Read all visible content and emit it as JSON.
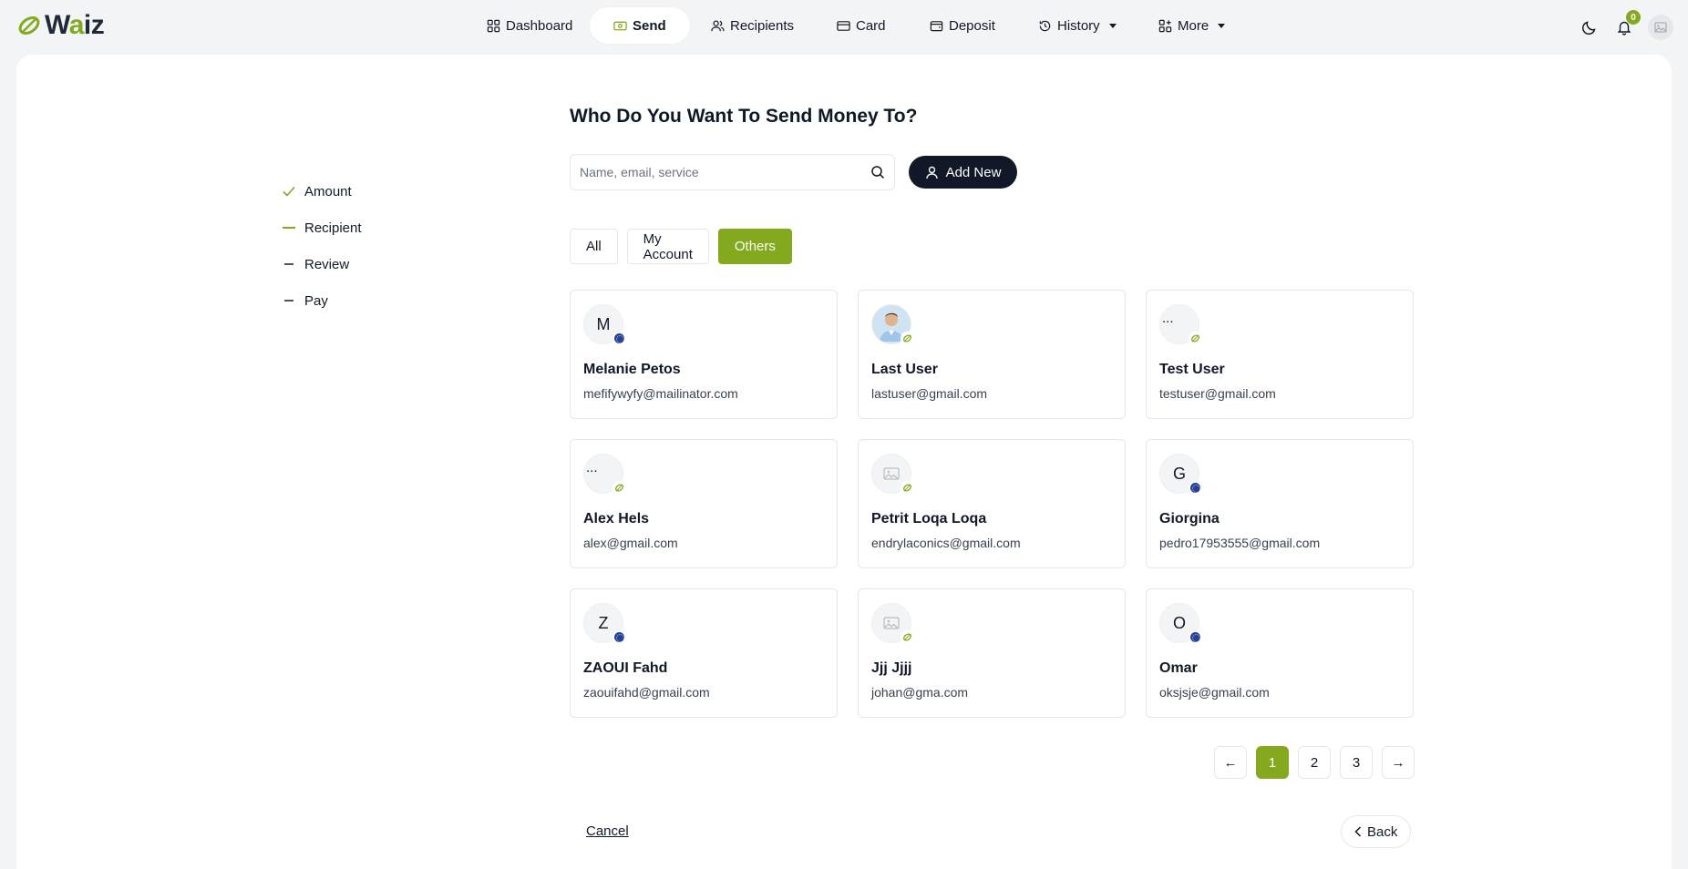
{
  "app": {
    "logo_text": "Waiz",
    "accent": "#84a91f"
  },
  "nav": {
    "items": [
      {
        "label": "Dashboard",
        "icon": "grid-icon"
      },
      {
        "label": "Send",
        "icon": "money-icon",
        "active": true
      },
      {
        "label": "Recipients",
        "icon": "users-icon"
      },
      {
        "label": "Card",
        "icon": "card-icon"
      },
      {
        "label": "Deposit",
        "icon": "wallet-icon"
      },
      {
        "label": "History",
        "icon": "history-icon",
        "dropdown": true
      },
      {
        "label": "More",
        "icon": "apps-icon",
        "dropdown": true
      }
    ],
    "notification_count": "0"
  },
  "steps": [
    {
      "label": "Amount",
      "state": "done"
    },
    {
      "label": "Recipient",
      "state": "current"
    },
    {
      "label": "Review",
      "state": "pending"
    },
    {
      "label": "Pay",
      "state": "pending"
    }
  ],
  "main": {
    "title": "Who Do You Want To Send Money To?",
    "search_placeholder": "Name, email, service",
    "search_value": "",
    "add_new_label": "Add New",
    "filters": [
      {
        "label": "All"
      },
      {
        "label": "My Account"
      },
      {
        "label": "Others",
        "active": true
      }
    ],
    "recipients": [
      {
        "initial": "M",
        "name": "Melanie Petos",
        "email": "mefifywyfy@mailinator.com",
        "avatar": "initial",
        "flag": "eu-flag-icon"
      },
      {
        "initial": "",
        "name": "Last User",
        "email": "lastuser@gmail.com",
        "avatar": "photo",
        "flag": "waiz-badge-icon"
      },
      {
        "initial": "...",
        "name": "Test User",
        "email": "testuser@gmail.com",
        "avatar": "initial",
        "flag": "waiz-badge-icon"
      },
      {
        "initial": "...",
        "name": "Alex Hels",
        "email": "alex@gmail.com",
        "avatar": "initial",
        "flag": "waiz-badge-icon"
      },
      {
        "initial": "",
        "name": "Petrit Loqa Loqa",
        "email": "endrylaconics@gmail.com",
        "avatar": "placeholder",
        "flag": "waiz-badge-icon"
      },
      {
        "initial": "G",
        "name": "Giorgina",
        "email": "pedro17953555@gmail.com",
        "avatar": "initial",
        "flag": "eu-flag-icon"
      },
      {
        "initial": "Z",
        "name": "ZAOUI Fahd",
        "email": "zaouifahd@gmail.com",
        "avatar": "initial",
        "flag": "eu-flag-icon"
      },
      {
        "initial": "",
        "name": "Jjj Jjjj",
        "email": "johan@gma.com",
        "avatar": "placeholder",
        "flag": "waiz-badge-icon"
      },
      {
        "initial": "O",
        "name": "Omar",
        "email": "oksjsje@gmail.com",
        "avatar": "initial",
        "flag": "eu-flag-icon"
      }
    ],
    "pagination": {
      "pages": [
        "1",
        "2",
        "3"
      ],
      "current": "1",
      "prev": "←",
      "next": "→"
    },
    "cancel_label": "Cancel",
    "back_label": "Back"
  }
}
